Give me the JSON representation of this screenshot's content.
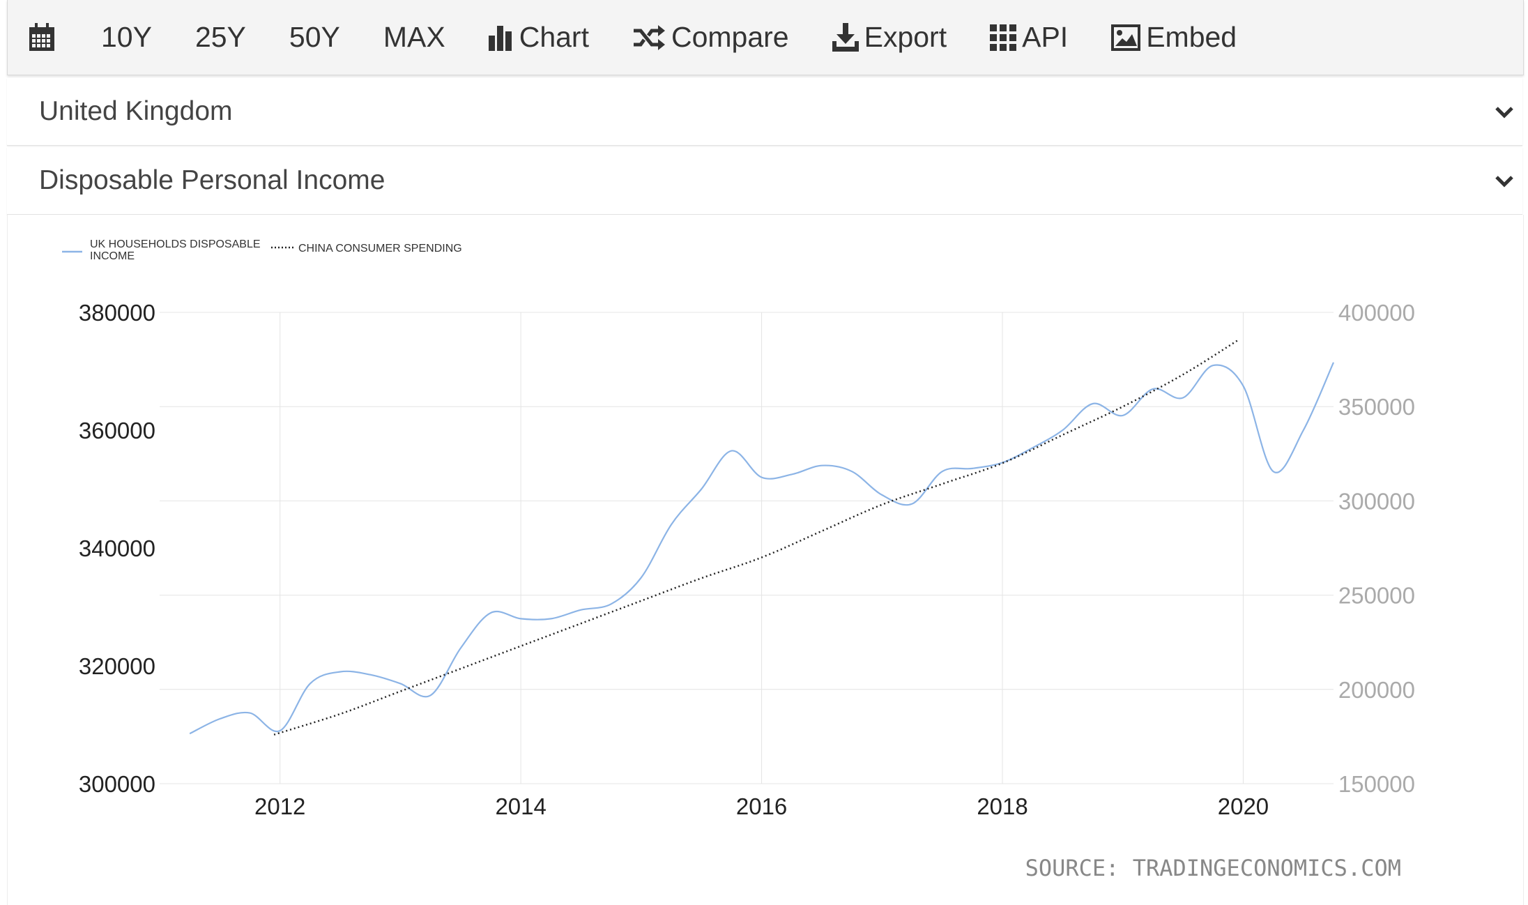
{
  "toolbar": {
    "items": [
      {
        "label": "",
        "icon": "calendar-icon"
      },
      {
        "label": "10Y",
        "icon": ""
      },
      {
        "label": "25Y",
        "icon": ""
      },
      {
        "label": "50Y",
        "icon": ""
      },
      {
        "label": "MAX",
        "icon": ""
      },
      {
        "label": "Chart",
        "icon": "bar-chart-icon"
      },
      {
        "label": "Compare",
        "icon": "shuffle-icon"
      },
      {
        "label": "Export",
        "icon": "download-icon"
      },
      {
        "label": "API",
        "icon": "grid-icon"
      },
      {
        "label": "Embed",
        "icon": "image-icon"
      }
    ]
  },
  "country_selector": {
    "value": "United Kingdom",
    "icon": "chevron-down-icon"
  },
  "indicator_selector": {
    "value": "Disposable Personal Income",
    "icon": "chevron-down-icon"
  },
  "colors": {
    "uk_line": "#8cb4e6",
    "china_line": "#222222",
    "grid": "#e4e4e4",
    "left_axis_text": "#222222",
    "right_axis_text": "#aaaaaa"
  },
  "source_text": "SOURCE: TRADINGECONOMICS.COM",
  "chart_data": {
    "type": "line",
    "legend": [
      {
        "label_lines": [
          "UK HOUSEHOLDS DISPOSABLE",
          "INCOME"
        ],
        "style": "solid",
        "color": "#8cb4e6"
      },
      {
        "label_lines": [
          "CHINA CONSUMER SPENDING"
        ],
        "style": "dotted",
        "color": "#222222"
      }
    ],
    "legend_position": "top-left",
    "grid": true,
    "x_ticks": [
      "2012",
      "2014",
      "2016",
      "2018",
      "2020"
    ],
    "xlim": [
      2011.0,
      2020.75
    ],
    "y_left": {
      "ticks": [
        "380000",
        "360000",
        "340000",
        "320000",
        "300000"
      ],
      "ylim": [
        300000,
        380000
      ]
    },
    "y_right": {
      "ticks": [
        "400000",
        "350000",
        "300000",
        "250000",
        "200000",
        "150000"
      ],
      "ylim": [
        150000,
        400000
      ]
    },
    "series": [
      {
        "name": "UK HOUSEHOLDS DISPOSABLE INCOME",
        "axis": "left",
        "x": [
          2011.25,
          2011.5,
          2011.75,
          2012.0,
          2012.25,
          2012.5,
          2012.75,
          2013.0,
          2013.25,
          2013.5,
          2013.75,
          2014.0,
          2014.25,
          2014.5,
          2014.75,
          2015.0,
          2015.25,
          2015.5,
          2015.75,
          2016.0,
          2016.25,
          2016.5,
          2016.75,
          2017.0,
          2017.25,
          2017.5,
          2017.75,
          2018.0,
          2018.25,
          2018.5,
          2018.75,
          2019.0,
          2019.25,
          2019.5,
          2019.75,
          2020.0,
          2020.25,
          2020.5,
          2020.75
        ],
        "y": [
          308500,
          311000,
          312000,
          309000,
          317000,
          319000,
          318500,
          317000,
          315000,
          323000,
          329000,
          328000,
          328000,
          329500,
          330500,
          335000,
          344000,
          350000,
          356500,
          352000,
          352500,
          354000,
          353000,
          349000,
          347500,
          353000,
          353500,
          354500,
          357000,
          360000,
          364500,
          362500,
          367000,
          365500,
          371000,
          367500,
          353000,
          360000,
          371500
        ]
      },
      {
        "name": "CHINA CONSUMER SPENDING",
        "axis": "right",
        "x": [
          2011.95,
          2012.5,
          2013.0,
          2013.5,
          2014.0,
          2014.5,
          2015.0,
          2015.5,
          2016.0,
          2016.5,
          2017.0,
          2017.5,
          2018.0,
          2018.5,
          2019.0,
          2019.5,
          2019.95
        ],
        "y": [
          176000,
          187000,
          199000,
          211000,
          223000,
          235000,
          247000,
          259000,
          270000,
          284000,
          298000,
          309000,
          320000,
          335000,
          350000,
          367000,
          385000
        ]
      }
    ]
  }
}
